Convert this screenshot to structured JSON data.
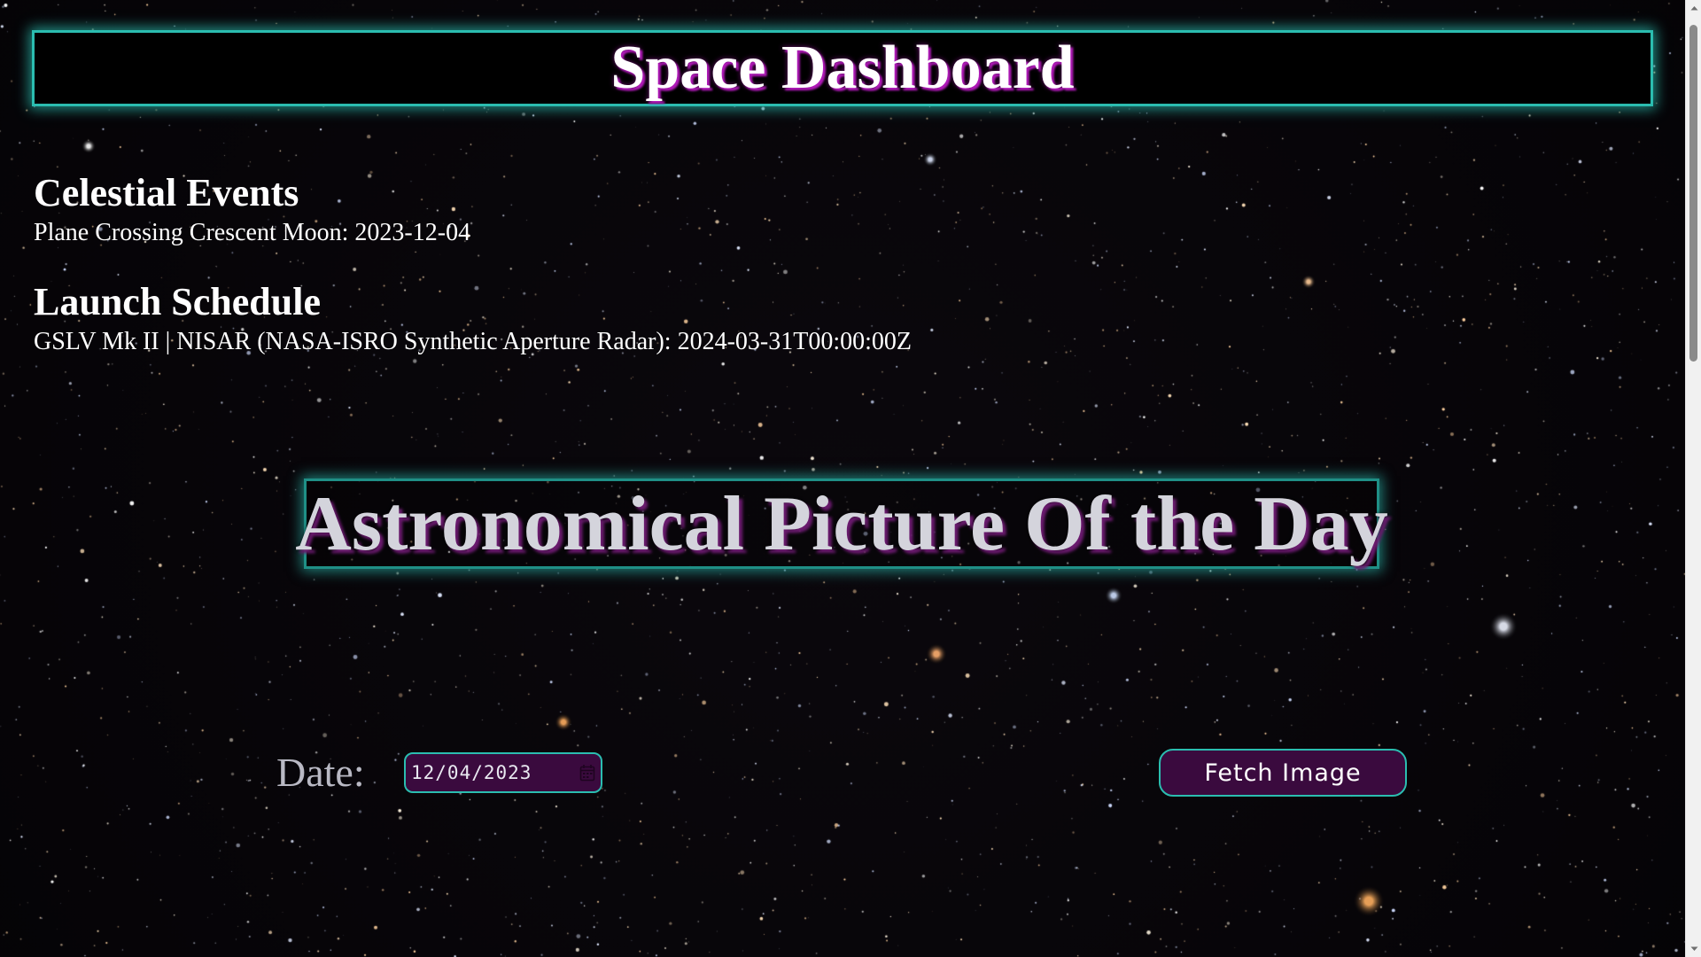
{
  "header": {
    "title": "Space Dashboard"
  },
  "celestial_events": {
    "heading": "Celestial Events",
    "event_text": "Plane Crossing Crescent Moon: 2023-12-04"
  },
  "launch_schedule": {
    "heading": "Launch Schedule",
    "launch_text": "GSLV Mk II | NISAR (NASA-ISRO Synthetic Aperture Radar): 2024-03-31T00:00:00Z"
  },
  "apod": {
    "heading": "Astronomical Picture Of the Day",
    "date_label": "Date:",
    "date_value": "12/04/2023",
    "fetch_button_label": "Fetch Image"
  },
  "icons": {
    "calendar": "calendar-icon",
    "scroll_up": "scroll-up-icon",
    "scroll_down": "scroll-down-icon"
  },
  "colors": {
    "accent_teal": "#2bbdb0",
    "control_purple": "#3a0a3e",
    "title_glow_magenta": "#b01ab8",
    "background": "#050407"
  }
}
